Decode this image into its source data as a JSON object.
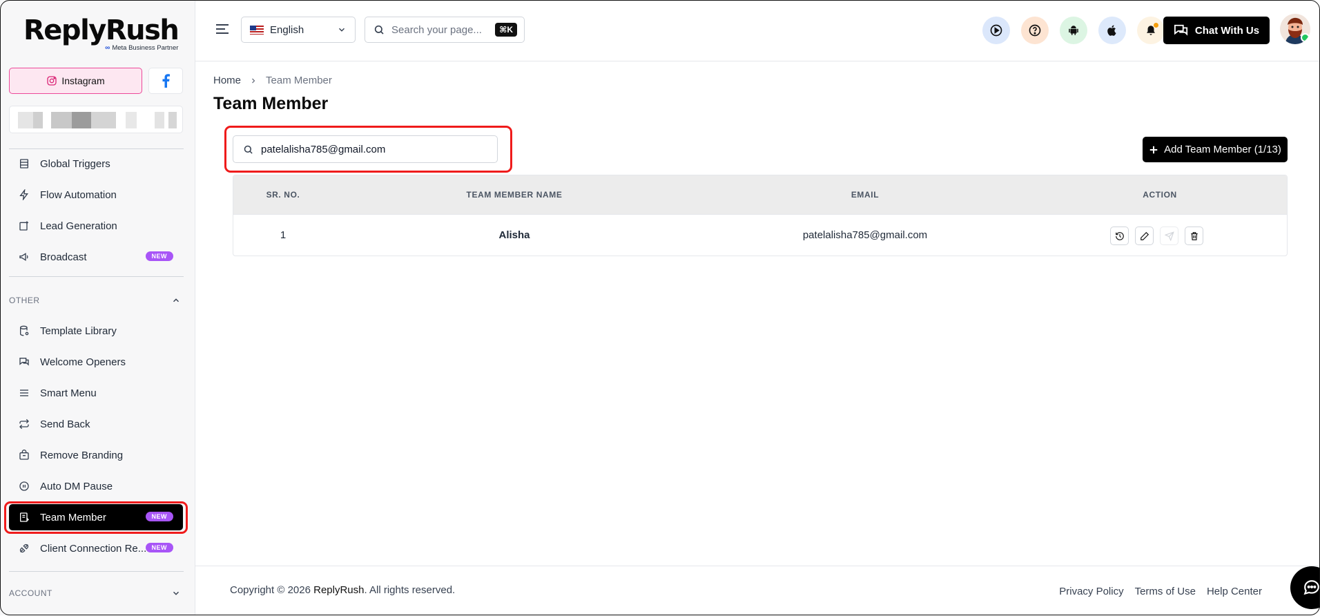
{
  "brand": {
    "name": "ReplyRush",
    "partner_label": "Meta Business Partner"
  },
  "platforms": {
    "instagram_label": "Instagram"
  },
  "sidebar": {
    "main_items": [
      {
        "label": "Global Triggers",
        "icon": "grid-icon"
      },
      {
        "label": "Flow Automation",
        "icon": "bolt-icon"
      },
      {
        "label": "Lead Generation",
        "icon": "lead-icon"
      },
      {
        "label": "Broadcast",
        "icon": "megaphone-icon",
        "badge": "NEW"
      }
    ],
    "other_section": "OTHER",
    "other_items": [
      {
        "label": "Template Library",
        "icon": "database-icon"
      },
      {
        "label": "Welcome Openers",
        "icon": "chat-icon"
      },
      {
        "label": "Smart Menu",
        "icon": "menu-icon"
      },
      {
        "label": "Send Back",
        "icon": "repeat-icon"
      },
      {
        "label": "Remove Branding",
        "icon": "bag-icon"
      },
      {
        "label": "Auto DM Pause",
        "icon": "pause-icon"
      },
      {
        "label": "Team Member",
        "icon": "document-icon",
        "badge": "NEW",
        "active": true
      },
      {
        "label": "Client Connection Re...",
        "icon": "plug-icon",
        "badge": "NEW"
      }
    ],
    "account_section": "ACCOUNT"
  },
  "header": {
    "language": "English",
    "search_placeholder": "Search your page...",
    "shortcut": "⌘K",
    "chat_label": "Chat With Us"
  },
  "breadcrumb": {
    "home": "Home",
    "current": "Team Member"
  },
  "page": {
    "title": "Team Member",
    "filter_value": "patelalisha785@gmail.com",
    "add_button": "Add Team Member (1/13)"
  },
  "table": {
    "headers": [
      "SR. NO.",
      "TEAM MEMBER NAME",
      "EMAIL",
      "ACTION"
    ],
    "rows": [
      {
        "sr": "1",
        "name": "Alisha",
        "email": "patelalisha785@gmail.com"
      }
    ]
  },
  "footer": {
    "copyright_prefix": "Copyright © 2026 ",
    "copyright_brand": "ReplyRush",
    "copyright_suffix": ". All rights reserved.",
    "links": [
      "Privacy Policy",
      "Terms of Use",
      "Help Center"
    ]
  },
  "colors": {
    "accent_badge": "#a855f7",
    "highlight": "#ef1b1b",
    "instagram_pink": "#ec4899",
    "facebook_blue": "#1877f2"
  }
}
